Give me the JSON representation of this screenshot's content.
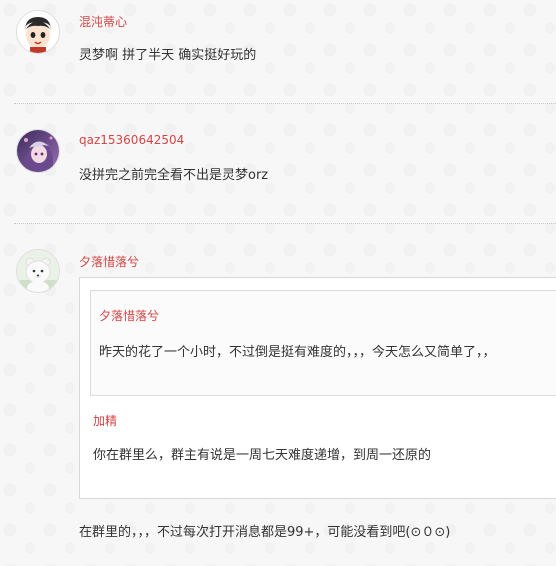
{
  "comments": [
    {
      "author": "混沌蒂心",
      "text": "灵梦啊 拼了半天 确实挺好玩的",
      "avatar_icon": "cartoon-face-avatar-icon"
    },
    {
      "author": "qaz15360642504",
      "text": "没拼完之前完全看不出是灵梦orz",
      "avatar_icon": "anime-girl-avatar-icon"
    },
    {
      "author": "夕落惜落兮",
      "avatar_icon": "white-bear-avatar-icon",
      "quote": {
        "inner": {
          "author": "夕落惜落兮",
          "text": "昨天的花了一个小时，不过倒是挺有难度的，，，今天怎么又简单了，，"
        },
        "author": "加精",
        "text": "你在群里么，群主有说是一周七天难度递增，到周一还原的"
      },
      "text": "在群里的，，，不过每次打开消息都是99+，可能没看到吧(⊙０⊙)"
    }
  ],
  "colors": {
    "author_name": "#d64545",
    "body_text": "#333333",
    "page_background": "#f7f7f7"
  }
}
